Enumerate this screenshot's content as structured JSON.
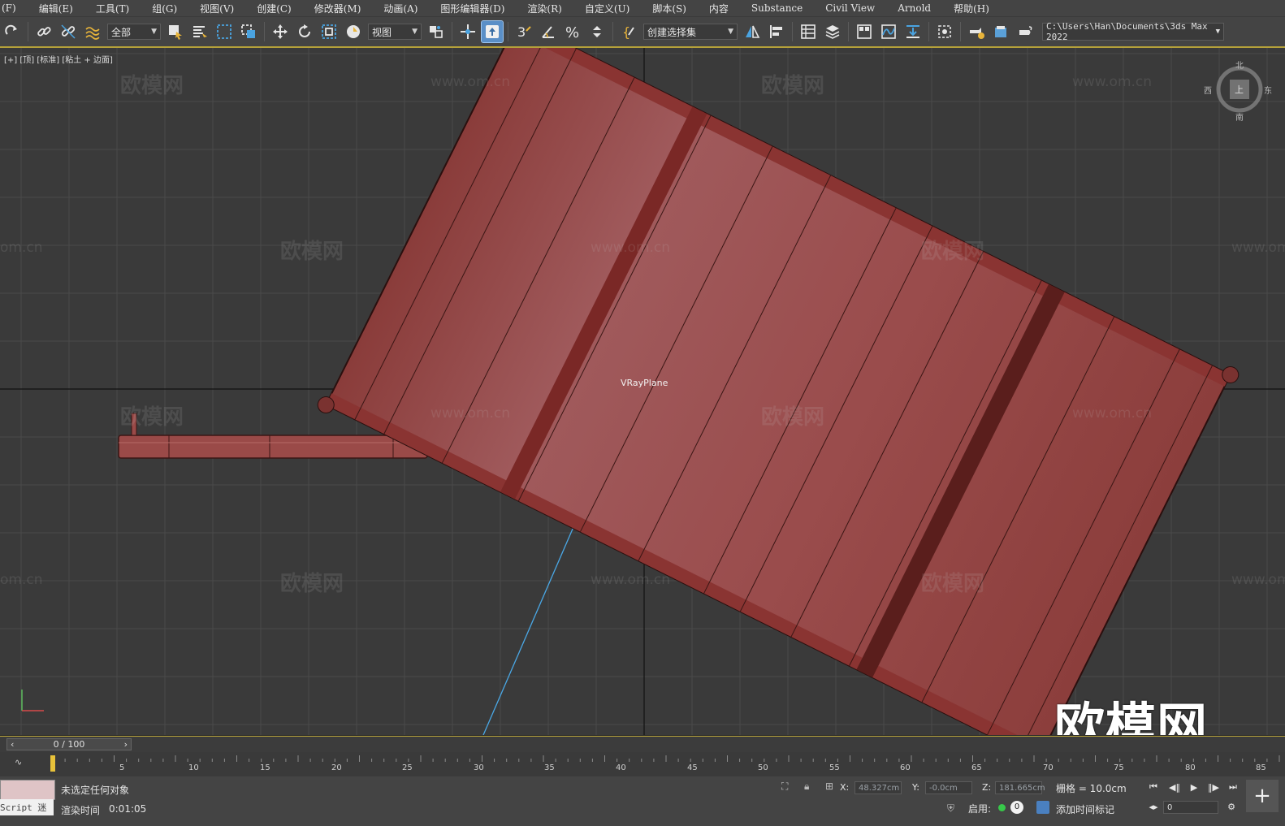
{
  "menubar": {
    "items": [
      "(F)",
      "编辑(E)",
      "工具(T)",
      "组(G)",
      "视图(V)",
      "创建(C)",
      "修改器(M)",
      "动画(A)",
      "图形编辑器(D)",
      "渲染(R)",
      "自定义(U)",
      "脚本(S)",
      "内容",
      "Substance",
      "Civil View",
      "Arnold",
      "帮助(H)"
    ]
  },
  "toolbar": {
    "selection_filter": "全部",
    "ref_coord": "视图",
    "named_selection": "创建选择集",
    "project_path": "C:\\Users\\Han\\Documents\\3ds Max 2022"
  },
  "viewport": {
    "label": "[+] [顶] [标准] [粘土 + 边面]",
    "object_label": "VRayPlane",
    "viewcube": {
      "top": "北",
      "left": "西",
      "right": "东",
      "bottom": "南",
      "face": "上"
    },
    "watermarks": {
      "brand": "欧模网",
      "url": "www.om.cn",
      "partial_url": "om.cn"
    },
    "big_watermark": "欧模网",
    "accent_color": "#b5a13a",
    "object_color": "#9a4a48"
  },
  "timeline": {
    "slider_text": "0 / 100",
    "current_frame": 0,
    "total_frames": 100,
    "ticks": [
      "5",
      "10",
      "15",
      "20",
      "25",
      "30",
      "35",
      "40",
      "45",
      "50",
      "55",
      "60",
      "65",
      "70",
      "75",
      "80",
      "85"
    ]
  },
  "status": {
    "script_label": "Script 迷",
    "selection": "未选定任何对象",
    "render_time_label": "渲染时间",
    "render_time_value": "0:01:05",
    "x_label": "X:",
    "x_value": "48.327cm",
    "y_label": "Y:",
    "y_value": "-0.0cm",
    "z_label": "Z:",
    "z_value": "181.665cm",
    "grid": "栅格 = 10.0cm",
    "enable_label": "启用:",
    "enable_count": "0",
    "add_time_tag": "添加时间标记",
    "frame_field": "0"
  }
}
